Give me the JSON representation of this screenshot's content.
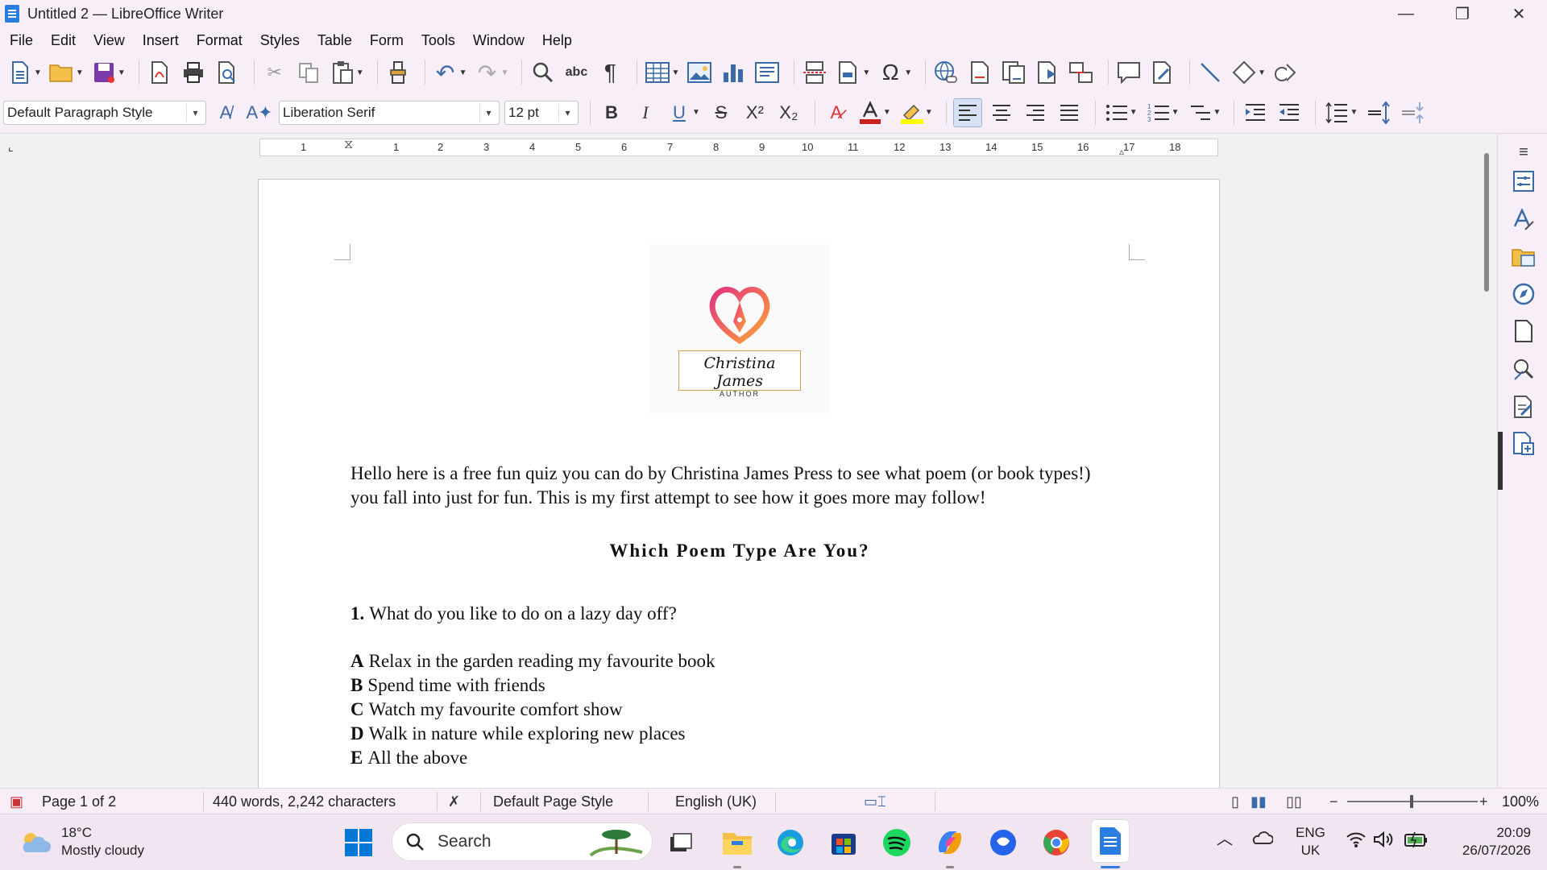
{
  "window": {
    "title": "Untitled 2 — LibreOffice Writer",
    "minimize": "—",
    "restore": "❐",
    "close": "✕"
  },
  "menu": [
    {
      "label": "File"
    },
    {
      "label": "Edit"
    },
    {
      "label": "View"
    },
    {
      "label": "Insert"
    },
    {
      "label": "Format"
    },
    {
      "label": "Styles"
    },
    {
      "label": "Table"
    },
    {
      "label": "Form"
    },
    {
      "label": "Tools"
    },
    {
      "label": "Window"
    },
    {
      "label": "Help"
    }
  ],
  "formatting": {
    "paragraph_style": "Default Paragraph Style",
    "font_name": "Liberation Serif",
    "font_size": "12 pt",
    "bold": "B",
    "italic": "I",
    "underline": "U",
    "strike": "S"
  },
  "ruler": {
    "numbers": [
      "1",
      "1",
      "2",
      "3",
      "4",
      "5",
      "6",
      "7",
      "8",
      "9",
      "10",
      "11",
      "12",
      "13",
      "14",
      "15",
      "16",
      "17",
      "18"
    ]
  },
  "document": {
    "logo": {
      "name": "Christina James",
      "subtitle": "AUTHOR"
    },
    "intro_line1": "Hello here is a free fun quiz you can do by Christina James Press to see what poem (or book types!)",
    "intro_line2": "you fall into just for fun. This is my first attempt to see how it goes more may follow!",
    "heading": "Which Poem Type Are You?",
    "question_number": "1.",
    "question_text": "What do you like to do on a lazy day off?",
    "options": [
      {
        "letter": "A",
        "text": "Relax in the garden reading my favourite book"
      },
      {
        "letter": "B",
        "text": "Spend time with friends"
      },
      {
        "letter": "C",
        "text": "Watch my favourite comfort show"
      },
      {
        "letter": "D",
        "text": "Walk in nature while exploring new places"
      },
      {
        "letter": "E",
        "text": "All the above"
      }
    ]
  },
  "status": {
    "page": "Page 1 of 2",
    "words": "440 words, 2,242 characters",
    "page_style": "Default Page Style",
    "language": "English (UK)",
    "zoom": "100%"
  },
  "taskbar": {
    "temperature": "18°C",
    "weather": "Mostly cloudy",
    "search_placeholder": "Search",
    "language_line1": "ENG",
    "language_line2": "UK",
    "time": "20:09",
    "date": "26/07/2026"
  },
  "colors": {
    "accent": "#3b6aa8",
    "chrome": "#f7eef7",
    "taskbar": "#f2e5f2"
  }
}
